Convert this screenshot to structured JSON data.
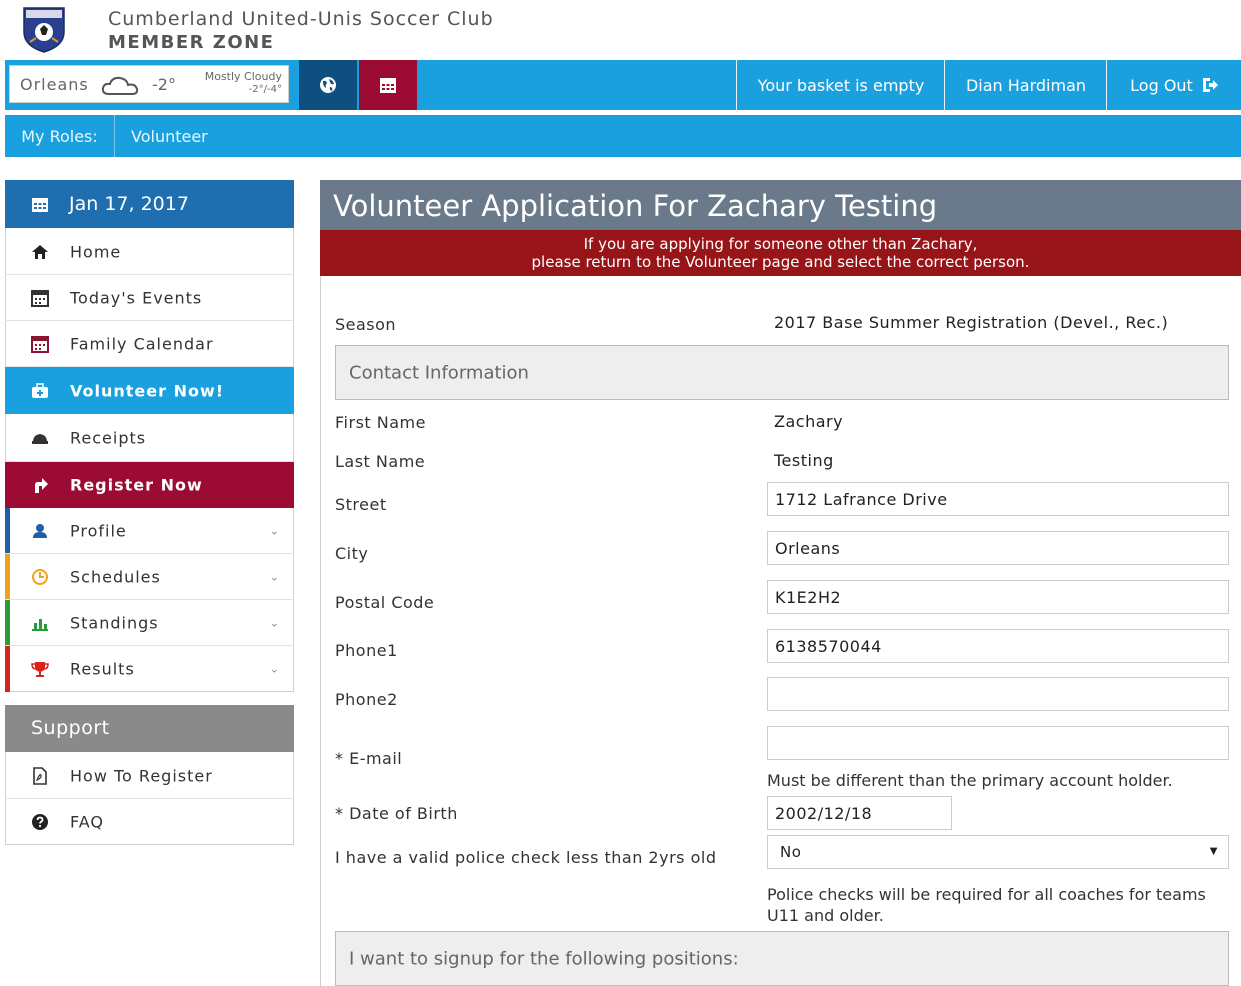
{
  "header": {
    "club_name": "Cumberland United-Unis Soccer Club",
    "zone_name": "MEMBER ZONE"
  },
  "topbar": {
    "weather": {
      "city": "Orleans",
      "temperature": "-2°",
      "condition": "Mostly Cloudy",
      "range": "-2°/-4°",
      "icon": "cloud-icon"
    },
    "basket_text": "Your basket is empty",
    "user_name": "Dian Hardiman",
    "logout_label": "Log Out",
    "colors": {
      "bar": "#1ba0df",
      "globe_button": "#0f4f80",
      "calendar_button": "#9b0b33"
    }
  },
  "roles": {
    "label": "My Roles:",
    "value": "Volunteer"
  },
  "sidebar": {
    "date": "Jan 17, 2017",
    "items": [
      {
        "label": "Home",
        "icon": "home-icon"
      },
      {
        "label": "Today's Events",
        "icon": "calendar-icon"
      },
      {
        "label": "Family Calendar",
        "icon": "calendar-icon"
      },
      {
        "label": "Volunteer Now!",
        "icon": "medkit-icon",
        "active": true
      },
      {
        "label": "Receipts",
        "icon": "money-icon"
      },
      {
        "label": "Register Now",
        "icon": "arrow-icon",
        "highlight": true
      },
      {
        "label": "Profile",
        "icon": "user-icon",
        "expandable": true,
        "accent": "#1f5fa8"
      },
      {
        "label": "Schedules",
        "icon": "clock-icon",
        "expandable": true,
        "accent": "#f0a020"
      },
      {
        "label": "Standings",
        "icon": "chart-icon",
        "expandable": true,
        "accent": "#2a9a3a"
      },
      {
        "label": "Results",
        "icon": "trophy-icon",
        "expandable": true,
        "accent": "#d9241c"
      }
    ]
  },
  "support": {
    "title": "Support",
    "items": [
      {
        "label": "How To Register",
        "icon": "pdf-icon"
      },
      {
        "label": "FAQ",
        "icon": "question-icon"
      }
    ]
  },
  "main": {
    "title": "Volunteer Application For Zachary Testing",
    "warning_line1": "If you are applying for someone other than Zachary,",
    "warning_line2": "please return to the Volunteer page and select the correct person.",
    "season_label": "Season",
    "season_value": "2017 Base Summer Registration (Devel., Rec.)",
    "contact_section": "Contact Information",
    "first_name_label": "First Name",
    "first_name_value": "Zachary",
    "last_name_label": "Last Name",
    "last_name_value": "Testing",
    "street_label": "Street",
    "street_value": "1712 Lafrance Drive",
    "city_label": "City",
    "city_value": "Orleans",
    "postal_label": "Postal Code",
    "postal_value": "K1E2H2",
    "phone1_label": "Phone1",
    "phone1_value": "6138570044",
    "phone2_label": "Phone2",
    "phone2_value": "",
    "email_label": "* E-mail",
    "email_value": "",
    "email_note": "Must be different than the primary account holder.",
    "dob_label": "* Date of Birth",
    "dob_value": "2002/12/18",
    "police_label": "I have a valid police check less than 2yrs old",
    "police_value": "No",
    "police_note": "Police checks will be required for all coaches for teams U11 and older.",
    "positions_section": "I want to signup for the following positions:"
  }
}
